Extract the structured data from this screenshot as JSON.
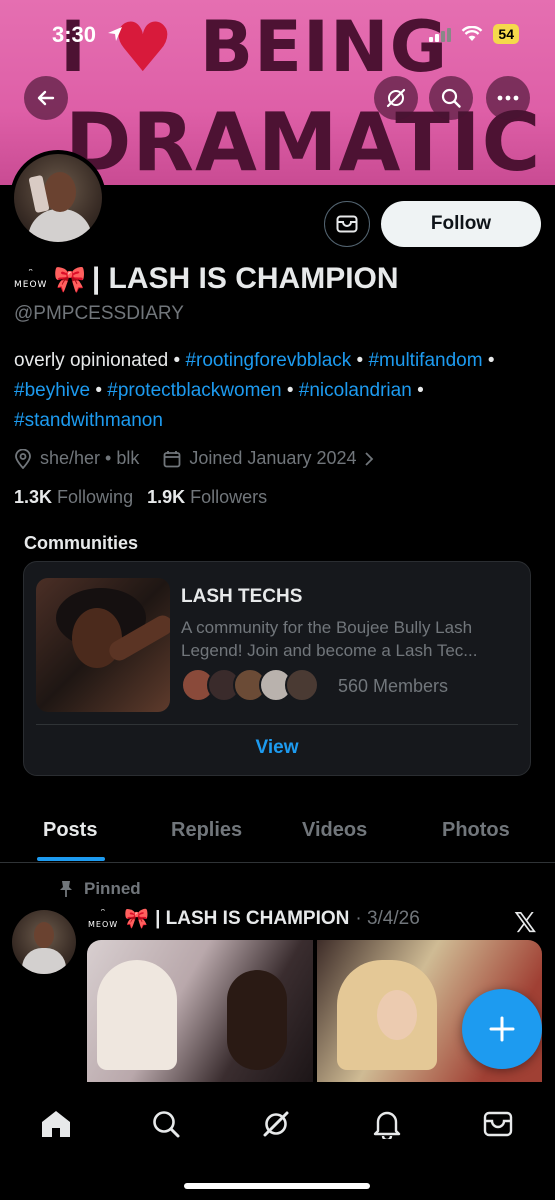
{
  "status_bar": {
    "time": "3:30",
    "battery": "54"
  },
  "banner": {
    "line1_pre": "I",
    "line1_post": "BEING",
    "line2": "DRAMATIC"
  },
  "profile": {
    "meow": "MEOW",
    "bow": "🎀",
    "display_name": "| LASH IS CHAMPION",
    "handle": "@PMPCESSDIARY",
    "follow_label": "Follow",
    "bio_plain": "overly opinionated",
    "bio_tags": [
      "#rootingforevbblack",
      "#multifandom",
      "#beyhive",
      "#protectblackwomen",
      "#nicolandrian",
      "#standwithmanon"
    ],
    "pronouns": "she/her • blk",
    "joined": "Joined January 2024",
    "following_count": "1.3K",
    "following_label": "Following",
    "followers_count": "1.9K",
    "followers_label": "Followers"
  },
  "communities": {
    "heading": "Communities",
    "card": {
      "name": "LASH TECHS",
      "description": "A community for the Boujee Bully Lash Legend! Join and become a Lash Tec...",
      "members": "560 Members",
      "view_label": "View"
    }
  },
  "tabs": [
    "Posts",
    "Replies",
    "Videos",
    "Photos"
  ],
  "pinned_post": {
    "pinned_label": "Pinned",
    "author": "| LASH IS CHAMPION",
    "date": "· 3/4/26"
  },
  "colors": {
    "accent": "#1d9bf0",
    "banner": "#e56fb1",
    "background": "#000000"
  }
}
